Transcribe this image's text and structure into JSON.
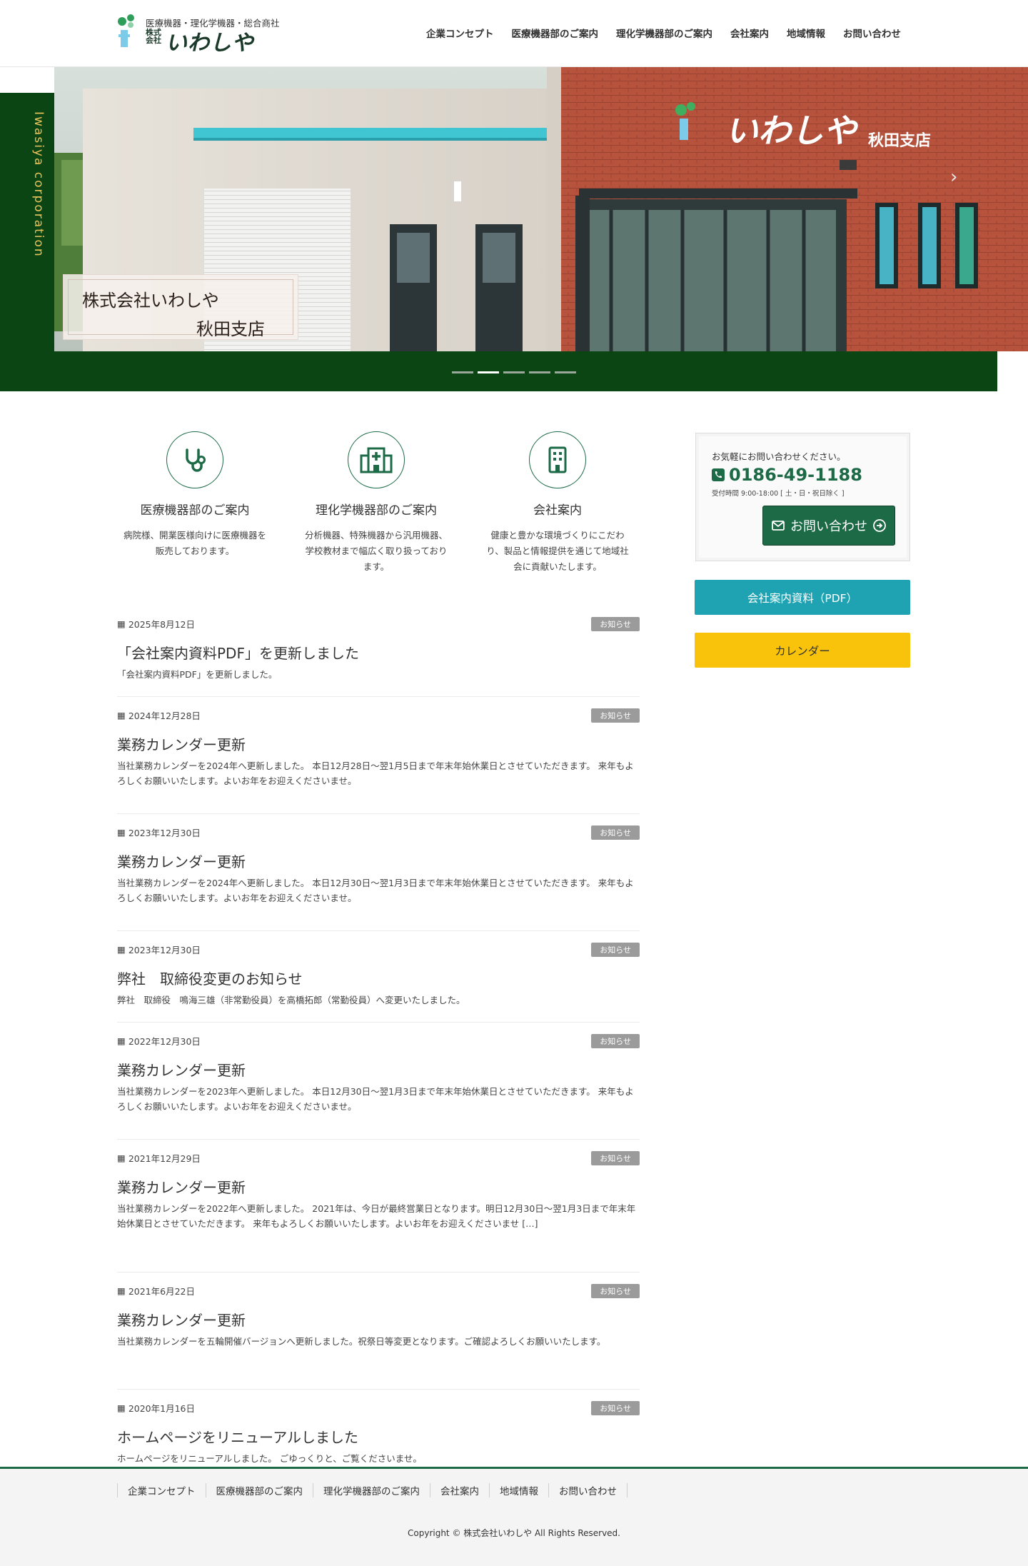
{
  "header": {
    "logo_tagline": "医療機器・理化学機器・総合商社",
    "logo_kabu": "株式会社",
    "logo_name": "いわしや",
    "nav": [
      "企業コンセプト",
      "医療機器部のご案内",
      "理化学機器部のご案内",
      "会社案内",
      "地域情報",
      "お問い合わせ"
    ]
  },
  "hero": {
    "side_label": "Iwasiya corporation",
    "sign_text": "いわしや",
    "sign_branch": "秋田支店",
    "caption_line1": "株式会社いわしや",
    "caption_line2": "秋田支店",
    "active_slide": 2,
    "slide_count": 5
  },
  "features": [
    {
      "icon": "stethoscope-icon",
      "title": "医療機器部のご案内",
      "text": "病院様、開業医様向けに医療機器を販売しております。"
    },
    {
      "icon": "hospital-icon",
      "title": "理化学機器部のご案内",
      "text": "分析機器、特殊機器から汎用機器、学校教材まで幅広く取り扱っております。"
    },
    {
      "icon": "building-icon",
      "title": "会社案内",
      "text": "健康と豊かな環境づくりにこだわり、製品と情報提供を通じて地域社会に貢献いたします。"
    }
  ],
  "news": [
    {
      "date": "2025年8月12日",
      "tag": "お知らせ",
      "title": "「会社案内資料PDF」を更新しました",
      "excerpt": "「会社案内資料PDF」を更新しました。"
    },
    {
      "date": "2024年12月28日",
      "tag": "お知らせ",
      "title": "業務カレンダー更新",
      "excerpt": "当社業務カレンダーを2024年へ更新しました。 本日12月28日～翌1月5日まで年末年始休業日とさせていただきます。 来年もよろしくお願いいたします。よいお年をお迎えくださいませ。"
    },
    {
      "date": "2023年12月30日",
      "tag": "お知らせ",
      "title": "業務カレンダー更新",
      "excerpt": "当社業務カレンダーを2024年へ更新しました。 本日12月30日～翌1月3日まで年末年始休業日とさせていただきます。 来年もよろしくお願いいたします。よいお年をお迎えくださいませ。"
    },
    {
      "date": "2023年12月30日",
      "tag": "お知らせ",
      "title": "弊社　取締役変更のお知らせ",
      "excerpt": "弊社　取締役　鳴海三雄（非常勤役員）を高橋拓郎（常勤役員）へ変更いたしました。"
    },
    {
      "date": "2022年12月30日",
      "tag": "お知らせ",
      "title": "業務カレンダー更新",
      "excerpt": "当社業務カレンダーを2023年へ更新しました。 本日12月30日～翌1月3日まで年末年始休業日とさせていただきます。 来年もよろしくお願いいたします。よいお年をお迎えくださいませ。"
    },
    {
      "date": "2021年12月29日",
      "tag": "お知らせ",
      "title": "業務カレンダー更新",
      "excerpt": "当社業務カレンダーを2022年へ更新しました。 2021年は、今日が最終営業日となります。明日12月30日～翌1月3日まで年末年始休業日とさせていただきます。 来年もよろしくお願いいたします。よいお年をお迎えくださいませ [&hellip;]"
    },
    {
      "date": "2021年6月22日",
      "tag": "お知らせ",
      "title": "業務カレンダー更新",
      "excerpt": "当社業務カレンダーを五輪開催バージョンへ更新しました。祝祭日等変更となります。ご確認よろしくお願いいたします。"
    },
    {
      "date": "2020年1月16日",
      "tag": "お知らせ",
      "title": "ホームページをリニューアルしました",
      "excerpt": "ホームページをリニューアルしました。 ごゆっくりと、ご覧くださいませ。"
    }
  ],
  "sidebar": {
    "contact_lead": "お気軽にお問い合わせください。",
    "phone": "0186-49-1188",
    "hours": "受付時間 9:00-18:00 [ 土・日・祝日除く ]",
    "contact_button": "お問い合わせ",
    "pdf_button": "会社案内資料（PDF）",
    "calendar_button": "カレンダー"
  },
  "footer": {
    "nav": [
      "企業コンセプト",
      "医療機器部のご案内",
      "理化学機器部のご案内",
      "会社案内",
      "地域情報",
      "お問い合わせ"
    ],
    "copyright": "Copyright © 株式会社いわしや All Rights Reserved."
  },
  "colors": {
    "brand_green": "#1d6a47",
    "dark_green": "#0b4513",
    "accent_gold": "#e7c25b",
    "pdf_teal": "#1fa3b2",
    "calendar_yellow": "#f8c30a"
  }
}
